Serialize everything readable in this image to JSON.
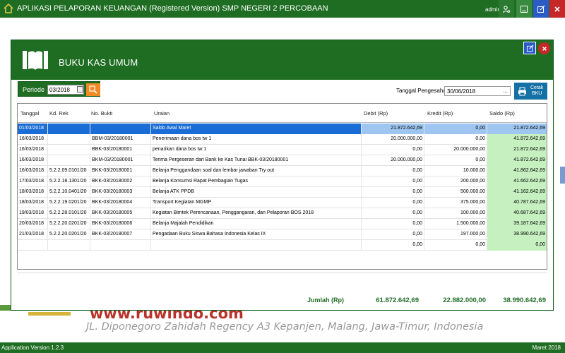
{
  "app": {
    "title": "APLIKASI PELAPORAN KEUANGAN (Registered Version) SMP NEGERI 2 PERCOBAAN",
    "user": "admin",
    "status_left": "Application Version 1.2.3",
    "status_right": "Maret 2018"
  },
  "background": {
    "website": "www.ruwindo.com",
    "address": "JL. Diponegoro Zahidah Regency A3 Kepanjen, Malang, Jawa-Timur, Indonesia"
  },
  "dialog": {
    "title": "BUKU KAS UMUM",
    "periode_label": "Periode",
    "periode_value": "03/2018",
    "pengesahan_label": "Tanggal Pengesahan",
    "pengesahan_value": "30/06/2018",
    "pengesahan_dots": "...",
    "cetak_line1": "Cetak",
    "cetak_line2": "BKU"
  },
  "table": {
    "columns": [
      "Tanggal",
      "Kd. Rek",
      "No. Bukti",
      "Uraian",
      "Debit (Rp)",
      "Kredit (Rp)",
      "Saldo (Rp)"
    ],
    "rows": [
      {
        "tanggal": "01/03/2018",
        "kd_rek": "",
        "no_bukti": "",
        "uraian": "Saldo Awal Maret",
        "debit": "21.872.642,69",
        "kredit": "0,00",
        "saldo": "21.872.642,69"
      },
      {
        "tanggal": "16/03/2018",
        "kd_rek": "",
        "no_bukti": "BBM-03/20180001",
        "uraian": "Penerimaan dana bos tw 1",
        "debit": "20.000.000,00",
        "kredit": "0,00",
        "saldo": "41.872.642,69"
      },
      {
        "tanggal": "16/03/2018",
        "kd_rek": "",
        "no_bukti": "BBK-03/20180001",
        "uraian": "penarikan dana bos tw 1",
        "debit": "0,00",
        "kredit": "20.000.000,00",
        "saldo": "21.872.642,69"
      },
      {
        "tanggal": "16/03/2018",
        "kd_rek": "",
        "no_bukti": "BKM-03/20180001",
        "uraian": "Terima Pergeseran dari Bank ke Kas Tunai BBK-03/20180001",
        "debit": "20.000.000,00",
        "kredit": "0,00",
        "saldo": "41.872.642,69"
      },
      {
        "tanggal": "16/03/2018",
        "kd_rek": "5.2.2.09.0101/20",
        "no_bukti": "BKK-03/20180001",
        "uraian": "Belanja Penggandaan soal dan lembar jawaban Try out",
        "debit": "0,00",
        "kredit": "10.000,00",
        "saldo": "41.862.642,69"
      },
      {
        "tanggal": "17/03/2018",
        "kd_rek": "5.2.2.18.1301/20",
        "no_bukti": "BKK-03/20180002",
        "uraian": "Belanja Konsumsi Rapat Pembagian Tugas",
        "debit": "0,00",
        "kredit": "200.000,00",
        "saldo": "41.662.642,69"
      },
      {
        "tanggal": "18/03/2018",
        "kd_rek": "5.2.2.10.0401/20",
        "no_bukti": "BKK-03/20180003",
        "uraian": "Belanja ATK PPDB",
        "debit": "0,00",
        "kredit": "500.000,00",
        "saldo": "41.162.642,69"
      },
      {
        "tanggal": "18/03/2018",
        "kd_rek": "5.2.2.19.0201/20",
        "no_bukti": "BKK-03/20180004",
        "uraian": "Transport Kegiatan MGMP",
        "debit": "0,00",
        "kredit": "375.000,00",
        "saldo": "40.787.642,69"
      },
      {
        "tanggal": "19/03/2018",
        "kd_rek": "5.2.2.28.0101/20",
        "no_bukti": "BKK-03/20180005",
        "uraian": "Kegiatan Bimtek Perencanaan, Penggangaran, dan Pelaporan BOS 2018",
        "debit": "0,00",
        "kredit": "100.000,00",
        "saldo": "40.687.642,69"
      },
      {
        "tanggal": "20/03/2018",
        "kd_rek": "5.2.2.20.0201/20",
        "no_bukti": "BKK-03/20180006",
        "uraian": "Belanja Majalah Pendidikan",
        "debit": "0,00",
        "kredit": "1.500.000,00",
        "saldo": "39.187.642,69"
      },
      {
        "tanggal": "21/03/2018",
        "kd_rek": "5.2.2.20.0201/20",
        "no_bukti": "BKK-03/20180007",
        "uraian": "Pengadaan Buku Siswa Bahasa Indonesia Kelas IX",
        "debit": "0,00",
        "kredit": "197.000,00",
        "saldo": "38.990.642,69"
      },
      {
        "tanggal": "",
        "kd_rek": "",
        "no_bukti": "",
        "uraian": "",
        "debit": "0,00",
        "kredit": "0,00",
        "saldo": "0,00"
      }
    ]
  },
  "totals": {
    "label": "Jumlah (Rp)",
    "debit": "61.872.642,69",
    "kredit": "22.882.000,00",
    "saldo": "38.990.642,69"
  },
  "colors": {
    "brand_green": "#1f6d23",
    "selection_blue": "#1a6dd6",
    "saldo_green": "#c6f0c0",
    "accent_orange": "#f08a24",
    "link_red": "#b8312a"
  },
  "icons": {
    "app": "house-icon",
    "user": "user-gear-icon",
    "minimize": "minimize-icon",
    "maximize": "edit-window-icon",
    "close": "close-icon",
    "dialog": "book-icon",
    "periode_search": "search-icon",
    "cetak": "printer-icon"
  }
}
